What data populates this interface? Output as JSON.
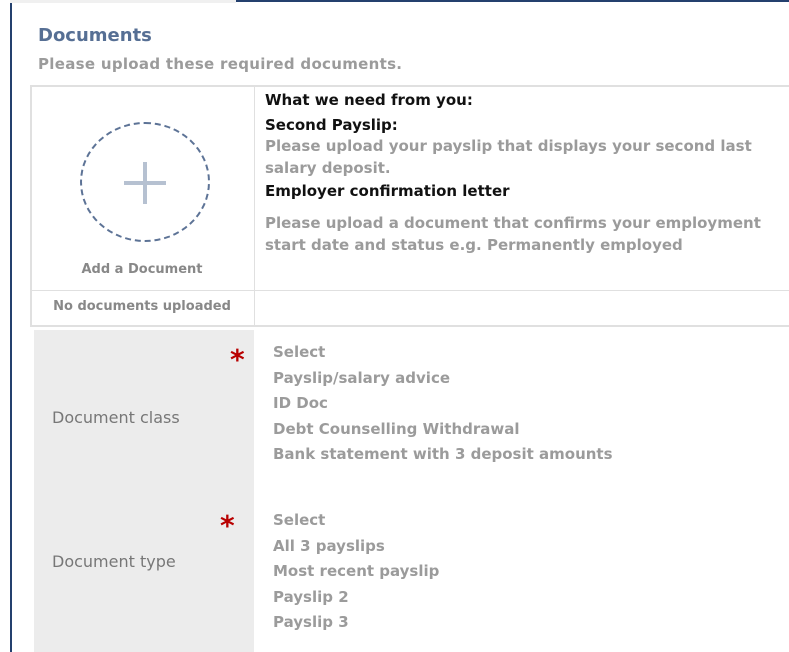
{
  "section": {
    "title": "Documents",
    "subtitle": "Please upload these required documents."
  },
  "upload": {
    "add_label": "Add a Document",
    "empty_status": "No documents uploaded"
  },
  "requirements": {
    "heading": "What we need from you:",
    "items": [
      {
        "title": "Second Payslip:",
        "description": "Please upload your payslip that displays your second last salary deposit."
      },
      {
        "title": "Employer confirmation letter",
        "description": "Please upload a document that confirms your employment start date and status e.g. Permanently employed"
      }
    ]
  },
  "form": {
    "required_marker": "*",
    "document_class": {
      "label": "Document class",
      "options": [
        "Select",
        "Payslip/salary advice",
        "ID Doc",
        "Debt Counselling Withdrawal",
        "Bank statement with 3 deposit amounts"
      ]
    },
    "document_type": {
      "label": "Document type",
      "options": [
        "Select",
        "All 3 payslips",
        "Most recent payslip",
        "Payslip 2",
        "Payslip 3"
      ]
    }
  },
  "colors": {
    "accent": "#566f94",
    "frame": "#24406e",
    "required": "#b80000",
    "muted_text": "#9b9b9b"
  },
  "icons": {
    "add": "plus-icon",
    "required": "asterisk-icon"
  }
}
